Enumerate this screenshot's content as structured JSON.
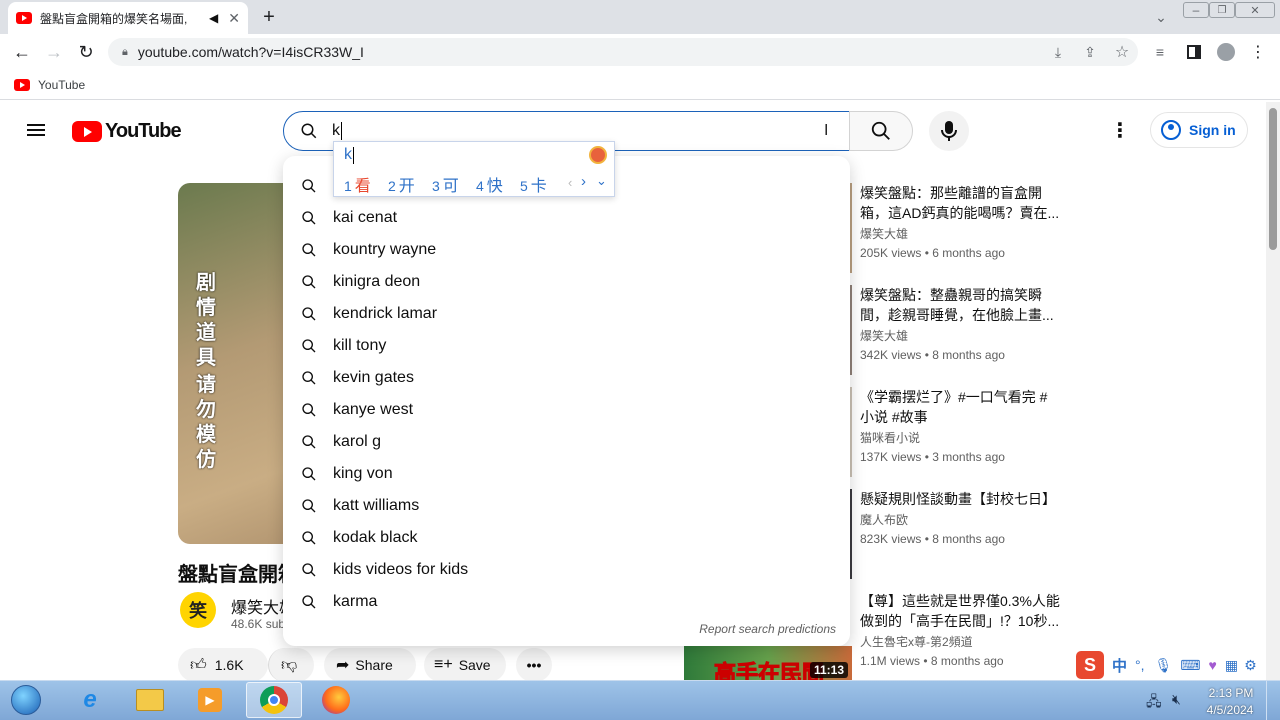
{
  "browser": {
    "tab_title": "盤點盲盒開箱的爆笑名場面,",
    "url": "youtube.com/watch?v=I4isCR33W_I",
    "bookmark": "YouTube"
  },
  "header": {
    "logo": "YouTube",
    "search_value": "k",
    "signin_label": "Sign in"
  },
  "ime": {
    "input": "k",
    "candidates": [
      {
        "n": "1",
        "c": "看"
      },
      {
        "n": "2",
        "c": "开"
      },
      {
        "n": "3",
        "c": "可"
      },
      {
        "n": "4",
        "c": "快"
      },
      {
        "n": "5",
        "c": "卡"
      }
    ]
  },
  "suggestions": {
    "items": [
      "kai cenat",
      "kountry wayne",
      "kinigra deon",
      "kendrick lamar",
      "kill tony",
      "kevin gates",
      "kanye west",
      "karol g",
      "king von",
      "katt williams",
      "kodak black",
      "kids videos for kids",
      "karma"
    ],
    "report": "Report search predictions"
  },
  "video": {
    "title_partial": "盤點盲盒開箱",
    "channel_partial": "爆笑大雄",
    "subs_partial": "48.6K sub",
    "thumb_text_left": "剧情道具",
    "thumb_text_right": "请勿模仿",
    "avatar_char": "笑",
    "likes": "1.6K",
    "share_label": "Share",
    "save_label": "Save"
  },
  "sidebar": [
    {
      "title": "爆笑盤點：那些離譜的盲盒開箱，這AD鈣真的能喝嗎？賣在...",
      "channel": "爆笑大雄",
      "meta": "205K views  • 6 months ago"
    },
    {
      "title": "爆笑盤點：整蠱親哥的搞笑瞬間，趁親哥睡覺，在他臉上畫...",
      "channel": "爆笑大雄",
      "meta": "342K views  • 8 months ago"
    },
    {
      "title": "《学霸摆烂了》#一口气看完 #小说 #故事",
      "channel": "猫咪看小说",
      "meta": "137K views  • 3 months ago"
    },
    {
      "title": "懸疑規則怪談動畫【封校七日】",
      "channel": "魔人布欧",
      "meta": "823K views  • 8 months ago"
    },
    {
      "title": "【尊】這些就是世界僅0.3%人能做到的「高手在民間」!？10秒...",
      "channel": "人生魯宅x尊-第2頻道",
      "meta": "1.1M views  • 8 months ago"
    }
  ],
  "sidebar_thumb": {
    "duration": "11:13",
    "caption": "高手在民間"
  },
  "taskbar": {
    "time": "2:13 PM",
    "date": "4/5/2024",
    "ime_label": "中"
  },
  "colors": {
    "accent_blue": "#065fd4",
    "yt_red": "#ff0000",
    "search_border": "#1c62b9"
  }
}
